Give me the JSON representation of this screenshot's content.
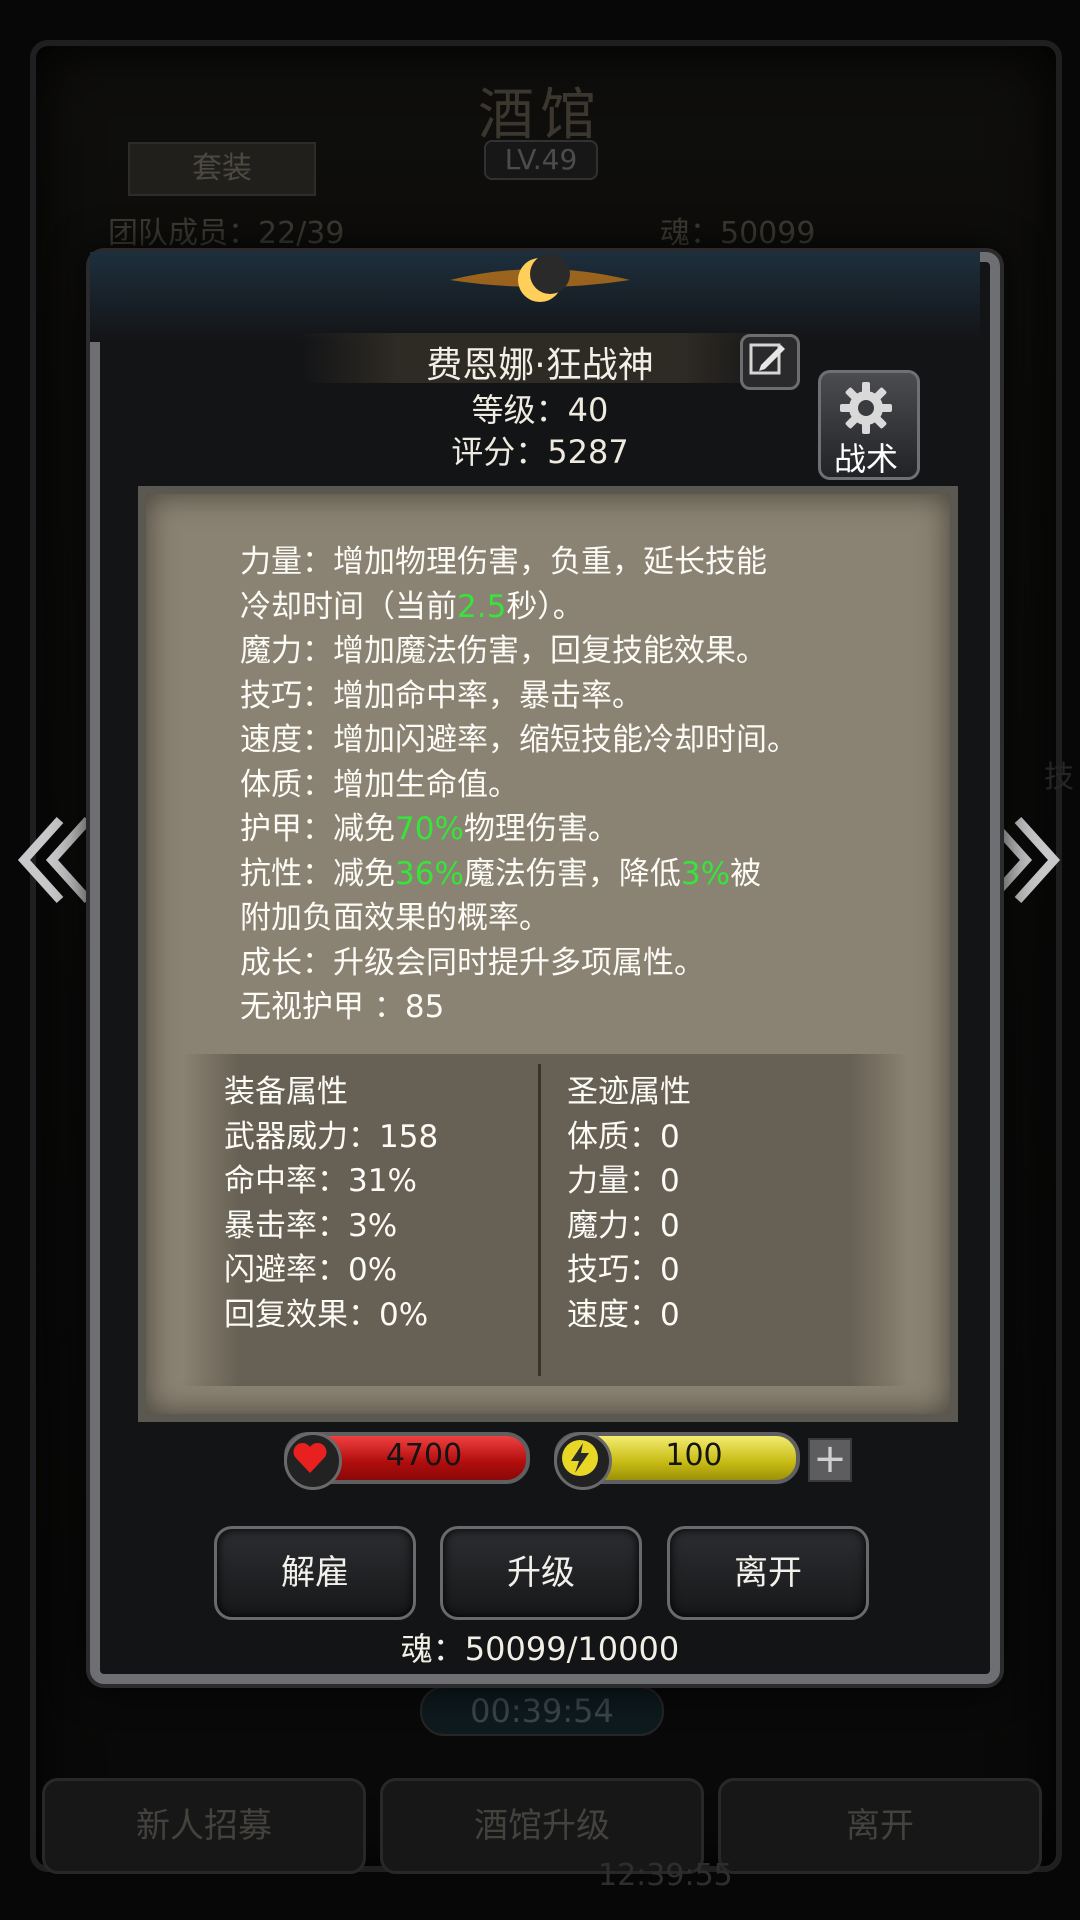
{
  "background": {
    "title": "酒馆",
    "level": "LV.49",
    "set_button": "套装",
    "members": "团队成员：22/39",
    "soul": "魂：50099",
    "timer": "00:39:54",
    "clock": "12:39:55",
    "side_text": "技",
    "buttons": [
      "新人招募",
      "酒馆升级",
      "离开"
    ]
  },
  "hero": {
    "name": "费恩娜·狂战神",
    "level": "等级：40",
    "score": "评分：5287"
  },
  "tactic_label": "战术",
  "description": [
    {
      "parts": [
        {
          "t": "力量：增加物理伤害，负重，延长技能"
        }
      ]
    },
    {
      "parts": [
        {
          "t": "冷却时间（当前"
        },
        {
          "t": "2.5",
          "hl": true
        },
        {
          "t": "秒）。"
        }
      ]
    },
    {
      "parts": [
        {
          "t": "魔力：增加魔法伤害，回复技能效果。"
        }
      ]
    },
    {
      "parts": [
        {
          "t": "技巧：增加命中率，暴击率。"
        }
      ]
    },
    {
      "parts": [
        {
          "t": "速度：增加闪避率，缩短技能冷却时间。"
        }
      ]
    },
    {
      "parts": [
        {
          "t": "体质：增加生命值。"
        }
      ]
    },
    {
      "parts": [
        {
          "t": "护甲：减免"
        },
        {
          "t": "70%",
          "hl": true
        },
        {
          "t": "物理伤害。"
        }
      ]
    },
    {
      "parts": [
        {
          "t": "抗性：减免"
        },
        {
          "t": "36%",
          "hl": true
        },
        {
          "t": "魔法伤害，降低"
        },
        {
          "t": "3%",
          "hl": true
        },
        {
          "t": "被"
        }
      ]
    },
    {
      "parts": [
        {
          "t": "附加负面效果的概率。"
        }
      ]
    },
    {
      "parts": [
        {
          "t": "成长：升级会同时提升多项属性。"
        }
      ]
    },
    {
      "parts": [
        {
          "t": "无视护甲 ：85"
        }
      ]
    }
  ],
  "equipment": {
    "title": "装备属性",
    "items": [
      "武器威力：158",
      "命中率：31%",
      "暴击率：3%",
      "闪避率：0%",
      "回复效果：0%"
    ]
  },
  "relic": {
    "title": "圣迹属性",
    "items": [
      "体质：0",
      "力量：0",
      "魔力：0",
      "技巧：0",
      "速度：0"
    ]
  },
  "hp": "4700",
  "energy": "100",
  "plus_label": "+",
  "buttons": {
    "dismiss": "解雇",
    "upgrade": "升级",
    "leave": "离开"
  },
  "soul_cost": "魂：50099/10000",
  "colors": {
    "highlight": "#36e43a",
    "hp": "#c81414",
    "energy": "#d8cc1e"
  }
}
